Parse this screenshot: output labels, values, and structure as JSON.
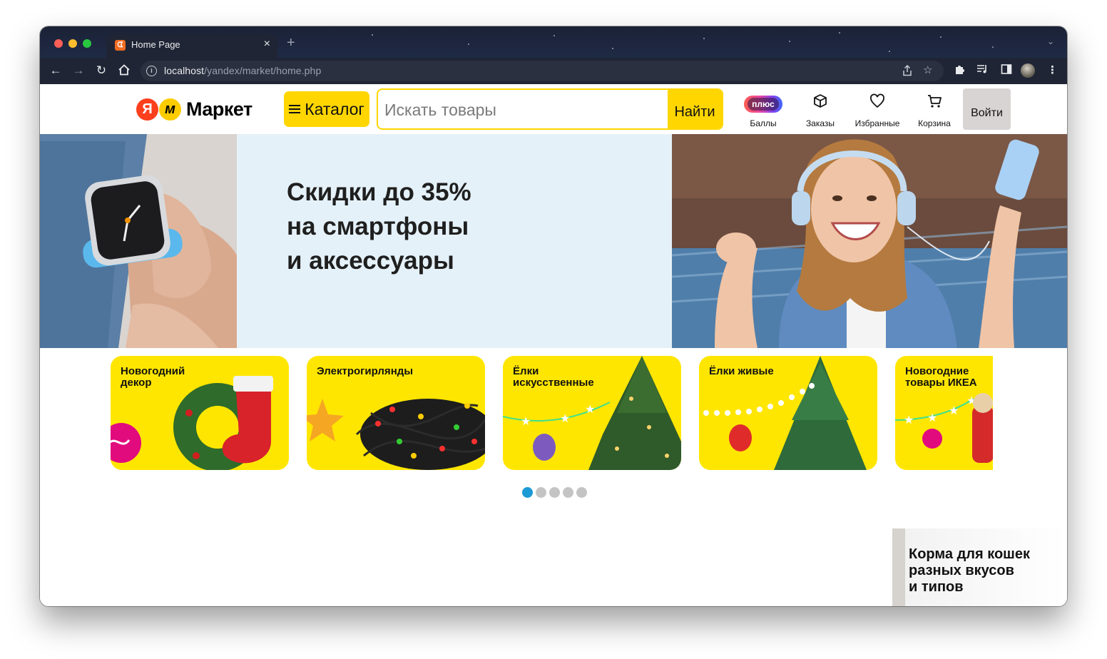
{
  "browser": {
    "tab_title": "Home Page",
    "tab_close": "×",
    "new_tab": "+",
    "url_host": "localhost",
    "url_path": "/yandex/market/home.php",
    "traffic_lights": [
      "#ff5f57",
      "#febc2e",
      "#28c840"
    ]
  },
  "header": {
    "logo_letter_1": "Я",
    "logo_letter_2": "м",
    "logo_text": "Маркет",
    "catalog_label": "Каталог",
    "search_placeholder": "Искать товары",
    "search_button": "Найти",
    "nav": {
      "points_badge": "плюс",
      "points_label": "Баллы",
      "orders_label": "Заказы",
      "favorites_label": "Избранные",
      "cart_label": "Корзина"
    },
    "login_label": "Войти",
    "accent_color": "#ffd600"
  },
  "hero": {
    "line_1": "Скидки до 35%",
    "line_2": "на смартфоны",
    "line_3": "и аксессуары"
  },
  "categories": [
    {
      "line_1": "Новогодний",
      "line_2": "декор"
    },
    {
      "line_1": "Электрогирлянды",
      "line_2": ""
    },
    {
      "line_1": "Ёлки",
      "line_2": "искусственные"
    },
    {
      "line_1": "Ёлки живые",
      "line_2": ""
    },
    {
      "line_1": "Новогодние",
      "line_2": "товары ИКЕА"
    }
  ],
  "carousel": {
    "count": 5,
    "active": 0,
    "active_color": "#1b9ad6"
  },
  "promo": {
    "line_1": "Корма для кошек",
    "line_2": "разных вкусов",
    "line_3": "и типов"
  }
}
